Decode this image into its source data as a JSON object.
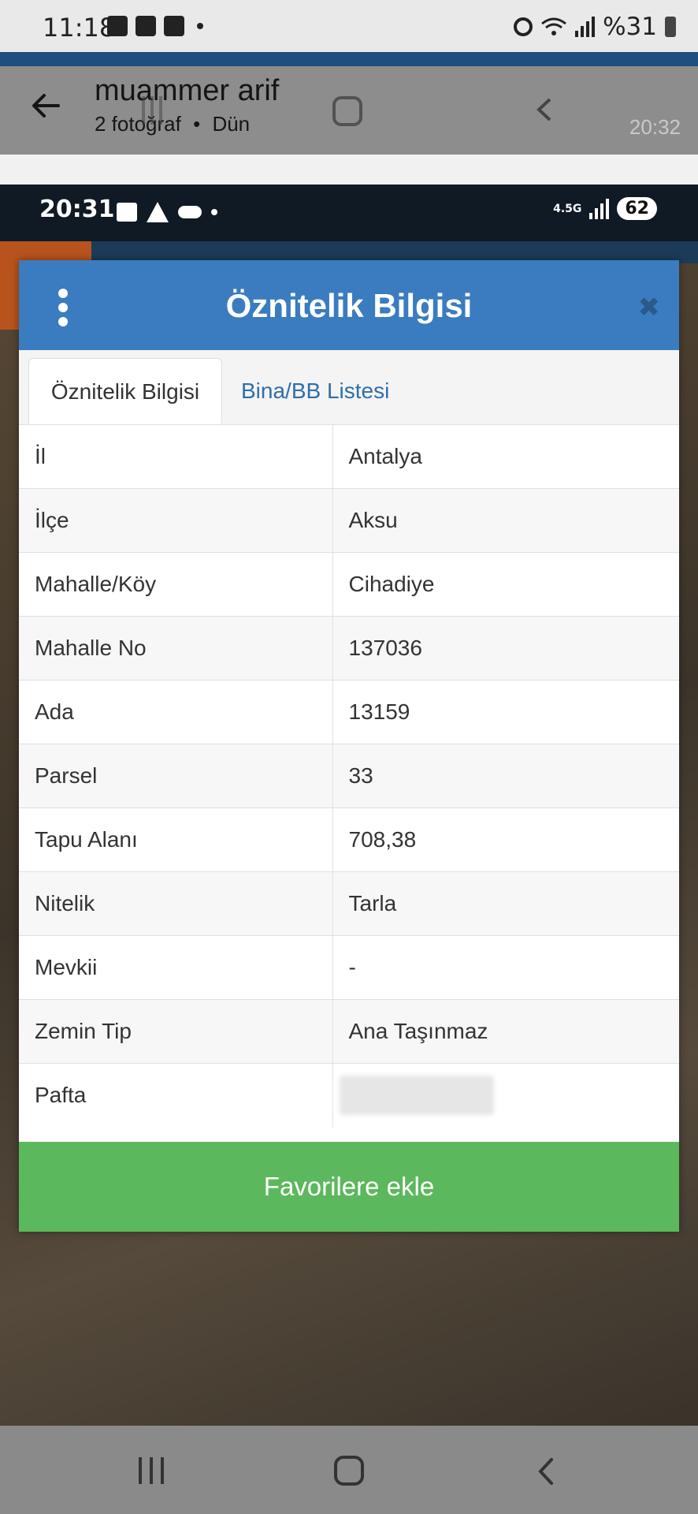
{
  "outer_status": {
    "time": "11:18",
    "battery": "%31"
  },
  "gallery": {
    "sender": "muammer arif",
    "photo_count": "2 fotoğraf",
    "separator": "•",
    "date": "Dün",
    "timestamp": "20:32"
  },
  "inner_status": {
    "time": "20:31",
    "network": "4.5G",
    "battery": "62"
  },
  "modal": {
    "title": "Öznitelik Bilgisi",
    "close_glyph": "✖",
    "tabs": [
      {
        "label": "Öznitelik Bilgisi",
        "active": true
      },
      {
        "label": "Bina/BB Listesi",
        "active": false
      }
    ],
    "rows": [
      {
        "key": "İl",
        "value": "Antalya"
      },
      {
        "key": "İlçe",
        "value": "Aksu"
      },
      {
        "key": "Mahalle/Köy",
        "value": "Cihadiye"
      },
      {
        "key": "Mahalle No",
        "value": "137036"
      },
      {
        "key": "Ada",
        "value": "13159"
      },
      {
        "key": "Parsel",
        "value": "33"
      },
      {
        "key": "Tapu Alanı",
        "value": "708,38"
      },
      {
        "key": "Nitelik",
        "value": "Tarla"
      },
      {
        "key": "Mevkii",
        "value": "-"
      },
      {
        "key": "Zemin Tip",
        "value": "Ana Taşınmaz"
      },
      {
        "key": "Pafta",
        "value": ""
      }
    ],
    "favorite_button": "Favorilere ekle"
  },
  "colors": {
    "header_blue": "#3a7cbf",
    "tab_link": "#2f6fa8",
    "button_green": "#5cb85c"
  }
}
